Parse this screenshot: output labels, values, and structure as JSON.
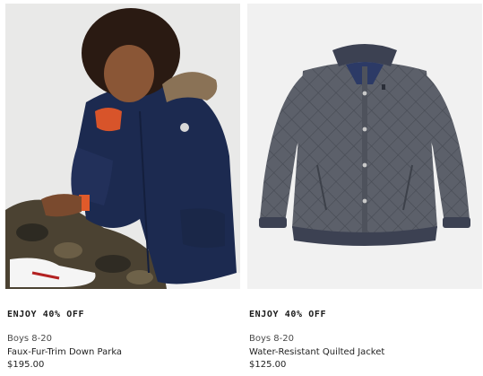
{
  "products": [
    {
      "image_alt": "Faux-Fur-Trim Down Parka",
      "promo": "ENJOY 40% OFF",
      "category": "Boys 8-20",
      "name": "Faux-Fur-Trim Down Parka",
      "price": "$195.00"
    },
    {
      "image_alt": "Water-Resistant Quilted Jacket",
      "promo": "ENJOY 40% OFF",
      "category": "Boys 8-20",
      "name": "Water-Resistant Quilted Jacket",
      "price": "$125.00"
    }
  ],
  "colors": {
    "parka": "#1c2a50",
    "quilted_jacket": "#5a5e68",
    "image_bg": "#eeeeee"
  }
}
